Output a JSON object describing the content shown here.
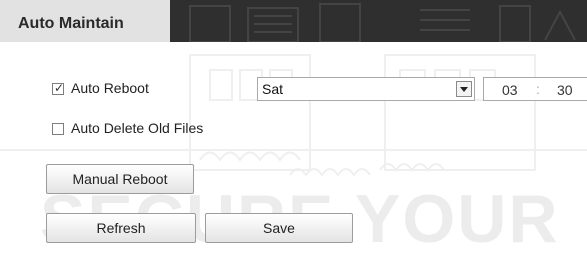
{
  "header": {
    "title": "Auto Maintain"
  },
  "auto_reboot": {
    "label": "Auto Reboot",
    "checked": true,
    "day_selected": "Sat",
    "time_hour": "03",
    "time_separator": ":",
    "time_minute": "30"
  },
  "auto_delete": {
    "label": "Auto Delete Old Files",
    "checked": false
  },
  "buttons": {
    "manual_reboot": "Manual Reboot",
    "refresh": "Refresh",
    "save": "Save"
  },
  "icons": {
    "checkmark": "✓"
  },
  "colors": {
    "title_bar": "#2f2f2f",
    "title_tab": "#e2e2e2"
  }
}
